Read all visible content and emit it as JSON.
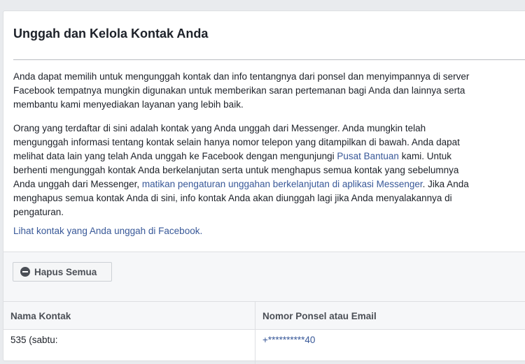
{
  "page": {
    "title": "Unggah dan Kelola Kontak Anda",
    "intro_lines": [
      "Anda dapat memilih untuk mengunggah kontak dan info tentangnya dari ponsel dan menyimpannya di server",
      "Facebook tempatnya mungkin digunakan untuk memberikan saran pertemanan bagi Anda dan lainnya serta",
      "membantu kami menyediakan layanan yang lebih baik."
    ],
    "detail": {
      "line1": "Orang yang terdaftar di sini adalah kontak yang Anda unggah dari Messenger. Anda mungkin telah",
      "line2": "mengunggah informasi tentang kontak selain hanya nomor telepon yang ditampilkan di bawah. Anda dapat",
      "line3_before": "melihat data lain yang telah Anda unggah ke Facebook dengan mengunjungi ",
      "help_link": "Pusat Bantuan",
      "line3_after": " kami. Untuk",
      "line4": "berhenti mengunggah kontak Anda berkelanjutan serta untuk menghapus semua kontak yang sebelumnya",
      "line5_before": "Anda unggah dari Messenger, ",
      "messenger_link": "matikan pengaturan unggahan berkelanjutan di aplikasi Messenger",
      "line5_after": ". Jika Anda",
      "line6": "menghapus semua kontak Anda di sini, info kontak Anda akan diunggah lagi jika Anda menyalakannya di",
      "line7": "pengaturan."
    },
    "view_link": "Lihat kontak yang Anda unggah di Facebook",
    "view_link_suffix": ".",
    "delete_all_button": "Hapus Semua",
    "table": {
      "columns": [
        "Nama Kontak",
        "Nomor Ponsel atau Email"
      ],
      "rows": [
        {
          "name": "535 (sabtu:",
          "contact": "+**********40"
        }
      ]
    },
    "colors": {
      "link": "#385898",
      "text": "#1d2129",
      "panel_bg": "#f6f7f9",
      "page_bg": "#e9ebee"
    },
    "icons": {
      "delete_button_icon": "minus-circle-icon"
    }
  }
}
